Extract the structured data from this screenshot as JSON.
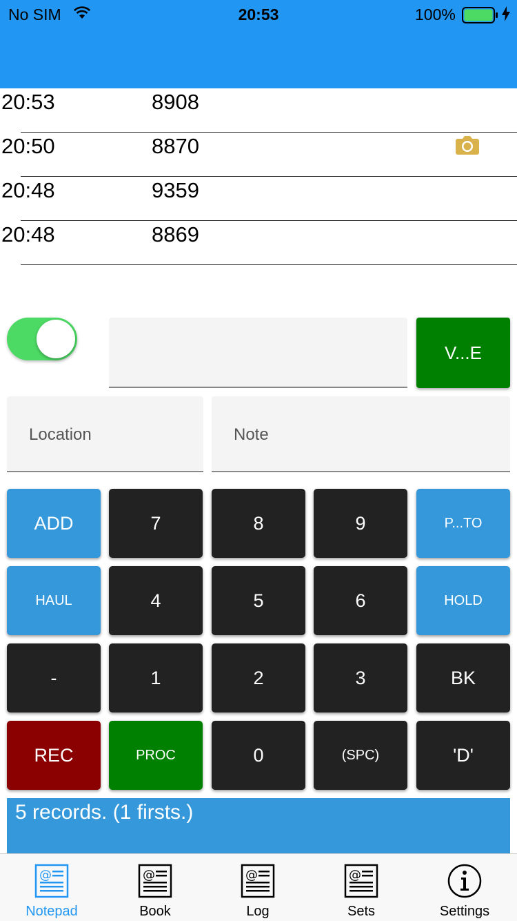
{
  "status_bar": {
    "carrier": "No SIM",
    "time": "20:53",
    "battery_percent": "100%",
    "battery_level": 1.0,
    "charging": true
  },
  "colors": {
    "header": "#2196F3",
    "accent_blue": "#3498DB",
    "key_dark": "#222222",
    "rec_red": "#8B0000",
    "proc_green": "#008000",
    "toggle_on": "#4CD964",
    "camera_icon": "#D9B24C"
  },
  "records": [
    {
      "time": "20:53",
      "number": "8908",
      "has_photo": false
    },
    {
      "time": "20:50",
      "number": "8870",
      "has_photo": true
    },
    {
      "time": "20:48",
      "number": "9359",
      "has_photo": false
    },
    {
      "time": "20:48",
      "number": "8869",
      "has_photo": false
    }
  ],
  "controls": {
    "toggle_on": true,
    "entry_value": "",
    "ve_button": "V...E",
    "location_placeholder": "Location",
    "note_placeholder": "Note"
  },
  "keypad": {
    "add": "ADD",
    "k7": "7",
    "k8": "8",
    "k9": "9",
    "photo": "P...TO",
    "haul": "HAUL",
    "k4": "4",
    "k5": "5",
    "k6": "6",
    "hold": "HOLD",
    "dash": "-",
    "k1": "1",
    "k2": "2",
    "k3": "3",
    "bk": "BK",
    "rec": "REC",
    "proc": "PROC",
    "k0": "0",
    "spc": "(SPC)",
    "d": "'D'"
  },
  "summary": "5 records. (1 firsts.)",
  "tabs": [
    {
      "label": "Notepad",
      "icon": "notepad-icon",
      "active": true
    },
    {
      "label": "Book",
      "icon": "book-icon",
      "active": false
    },
    {
      "label": "Log",
      "icon": "log-icon",
      "active": false
    },
    {
      "label": "Sets",
      "icon": "sets-icon",
      "active": false
    },
    {
      "label": "Settings",
      "icon": "info-icon",
      "active": false
    }
  ]
}
